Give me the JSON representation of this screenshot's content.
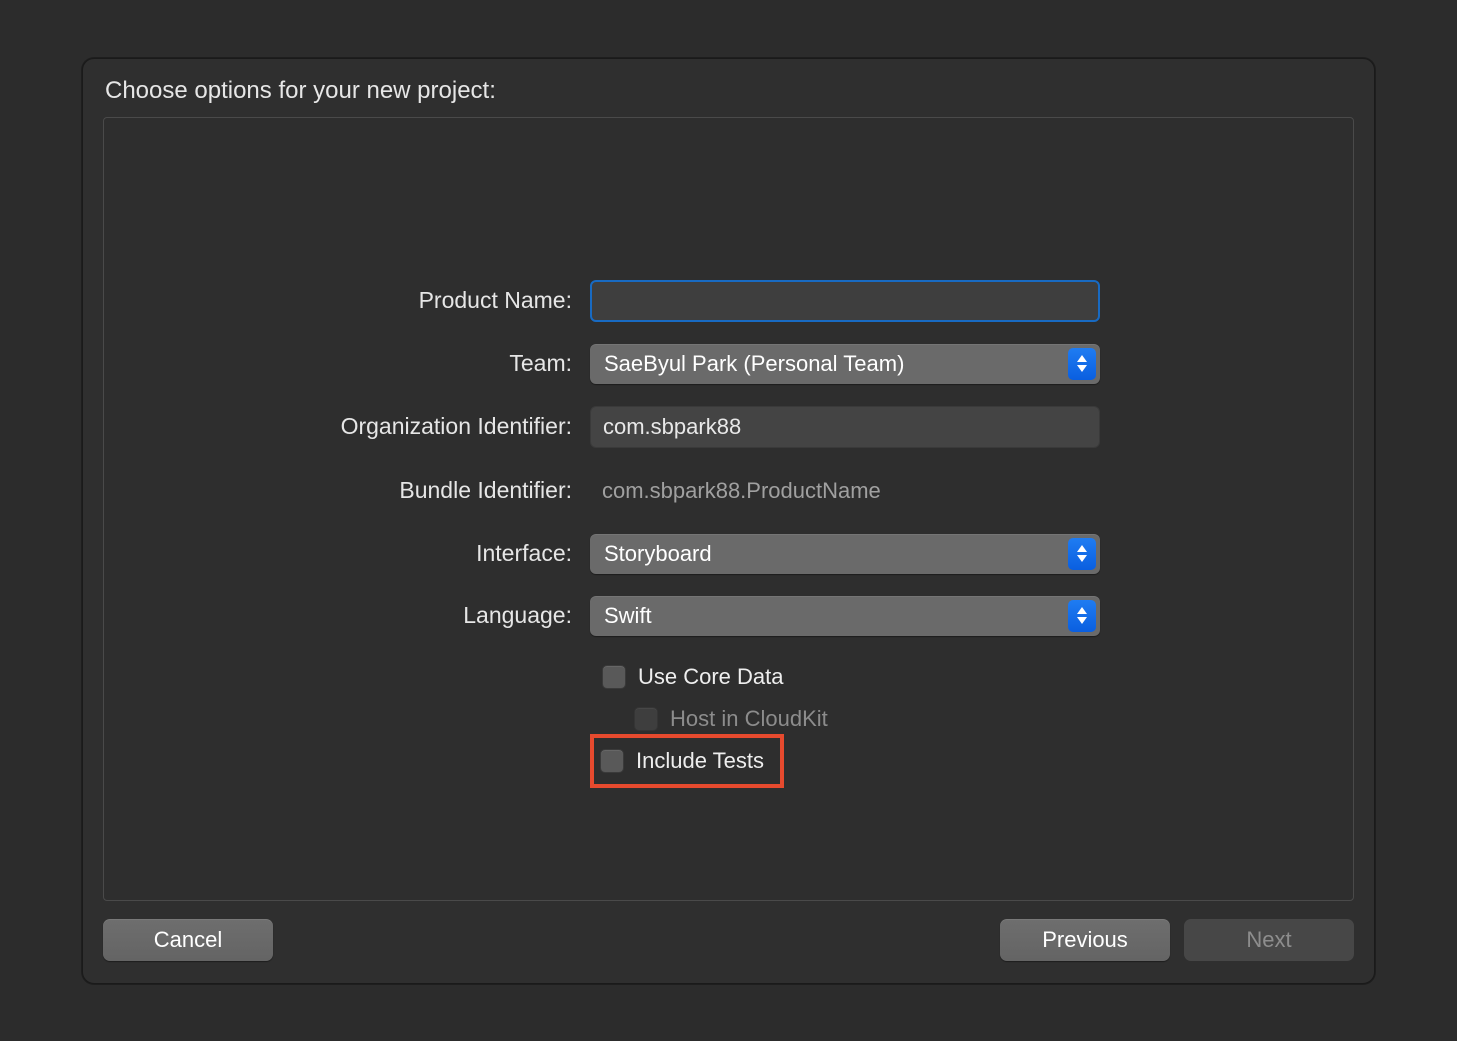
{
  "title": "Choose options for your new project:",
  "form": {
    "productName": {
      "label": "Product Name:",
      "value": ""
    },
    "team": {
      "label": "Team:",
      "value": "SaeByul Park (Personal Team)"
    },
    "orgIdentifier": {
      "label": "Organization Identifier:",
      "value": "com.sbpark88"
    },
    "bundleIdentifier": {
      "label": "Bundle Identifier:",
      "value": "com.sbpark88.ProductName"
    },
    "interface": {
      "label": "Interface:",
      "value": "Storyboard"
    },
    "language": {
      "label": "Language:",
      "value": "Swift"
    },
    "useCoreData": {
      "label": "Use Core Data",
      "checked": false
    },
    "hostCloudKit": {
      "label": "Host in CloudKit",
      "checked": false,
      "disabled": true
    },
    "includeTests": {
      "label": "Include Tests",
      "checked": false
    }
  },
  "buttons": {
    "cancel": "Cancel",
    "previous": "Previous",
    "next": "Next"
  }
}
